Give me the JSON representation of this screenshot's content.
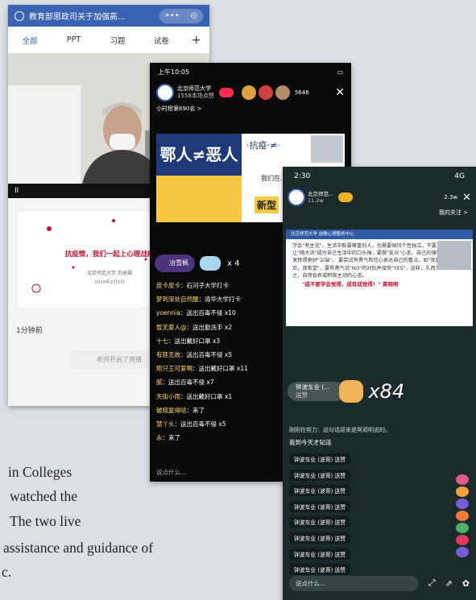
{
  "paragraph": {
    "line1": "in Colleges",
    "line2": "watched the",
    "line3": "The two live",
    "line4": "assistance and guidance of",
    "line5": "c."
  },
  "phone1": {
    "title": "教育部思政司关于加强高...",
    "capsule_more": "•••",
    "capsule_close": "◎",
    "tabs": [
      "全部",
      "PPT",
      "习题",
      "试卷"
    ],
    "add_tab": "+",
    "pause": "II",
    "card_heading": "抗疫情，我们一起上心理战疫",
    "card_sub1": "北京师范大学 刘迪福",
    "card_sub2": "2020年2月5日",
    "timestamp": "1分钟前",
    "notice": "老师开启了直播"
  },
  "phone2": {
    "status_time": "上午10:05",
    "host_name": "北京师范大学",
    "host_sub": "1558本场点赞",
    "viewers": "5646",
    "rank": "小时榜第690名 >",
    "slide1_text": "鄂人≠恶人",
    "slide2_title": "·抗疫·≠·",
    "slide2_sub": "我们在...",
    "slide2_badge": "新型",
    "gift_user": "冶雪枫",
    "gift_count": "x 4",
    "chat": [
      {
        "user": "皮卡皮卡",
        "text": "石河子大学打卡"
      },
      {
        "user": "梦到深处自然醒",
        "text": "清华大学打卡"
      },
      {
        "user": "yoennia",
        "text": "送出百毒不侵 x10"
      },
      {
        "user": "暂无爱人@",
        "text": "送出勤洗手 x2"
      },
      {
        "user": "十七",
        "text": "送出戴好口罩 x3"
      },
      {
        "user": "有匪无故",
        "text": "送出百毒不侵 x5"
      },
      {
        "user": "熙只王可爱啊",
        "text": "送出戴好口罩 x11"
      },
      {
        "user": "腻",
        "text": "送出百毒不侵 x7"
      },
      {
        "user": "天街小雨",
        "text": "送出戴好口罩 x1"
      },
      {
        "user": "破晓复得哒",
        "text": "来了"
      },
      {
        "user": "慧丫头",
        "text": "送出百毒不侵 x5"
      },
      {
        "user": "永",
        "text": "来了"
      }
    ],
    "input_placeholder": "说点什么...",
    "close": "✕"
  },
  "phone3": {
    "status_time": "2:30",
    "status_right": "4G",
    "host_name": "北京师范...",
    "host_likes": "11.2w",
    "viewers": "2.3w",
    "follow": "我的关注 >",
    "doc_header": "北京师范大学 前瞻心理服务中心",
    "doc_text": "学会\"有主见\"。生活中既要尊重别人，也需要保持个性独立。不要让\"随大流\"成为自己生活中的口头禅，要做\"友众\"心态，自己的强项发挥得更好\"尖端\"。 要尝试有勇气和信心表达自己的看法，如\"我喜欢，我希望\"。要有勇气说\"NO\"的对抗并接受\"YES\"，这样，久而久之，自然会养成积极主动的心态。",
    "doc_quote": "\"成不要学会觉得，成有成觉得！\" 黄晓明",
    "gift_user": "钟波车业 (...",
    "gift_action": "送赞",
    "gift_count": "x84",
    "system_msg": "刚刚在努力：这句话原来是冥顽明说的。",
    "system_msg2": "我到今天才知道",
    "likes": [
      "钟波车业 (波哥) 送赞",
      "钟波车业 (波哥) 送赞",
      "钟波车业 (波哥) 送赞",
      "钟波车业 (波哥) 送赞",
      "钟波车业 (波哥) 送赞",
      "钟波车业 (波哥) 送赞",
      "钟波车业 (波哥) 送赞",
      "钟波车业 (波哥) 送赞"
    ],
    "input_placeholder": "说点什么...",
    "close": "✕"
  }
}
